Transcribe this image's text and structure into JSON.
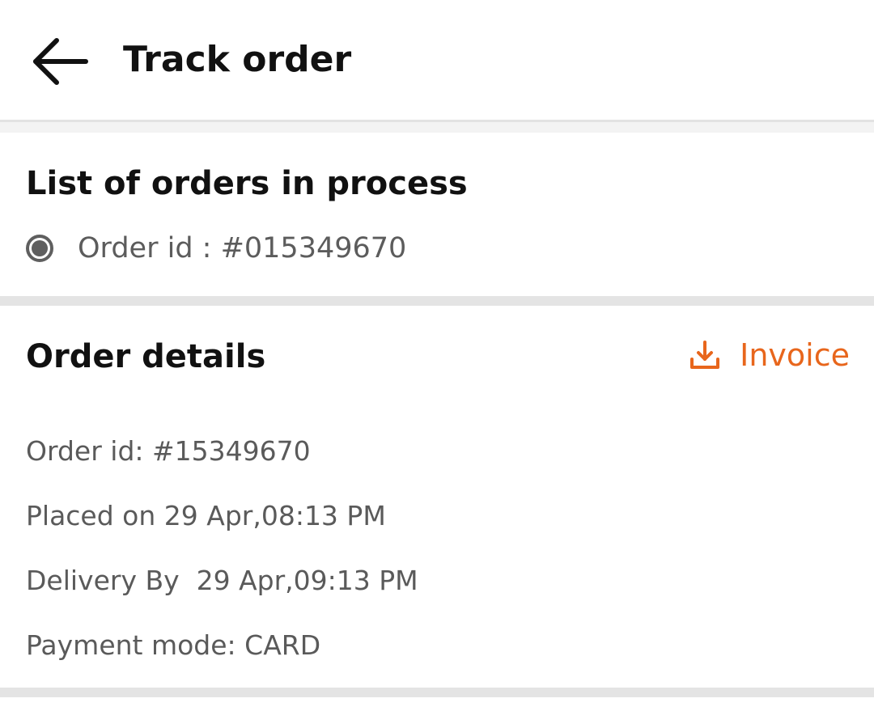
{
  "header": {
    "title": "Track order",
    "back_icon": "arrow-left-icon"
  },
  "process_section": {
    "title": "List of orders in process",
    "orders": [
      {
        "label": "Order id : #015349670",
        "selected": true
      }
    ]
  },
  "details_section": {
    "title": "Order details",
    "invoice": {
      "label": "Invoice",
      "icon": "download-icon",
      "color": "#e8661c"
    },
    "lines": [
      "Order id: #15349670",
      "Placed on 29 Apr,08:13 PM",
      "Delivery By  29 Apr,09:13 PM",
      "Payment mode: CARD"
    ]
  }
}
